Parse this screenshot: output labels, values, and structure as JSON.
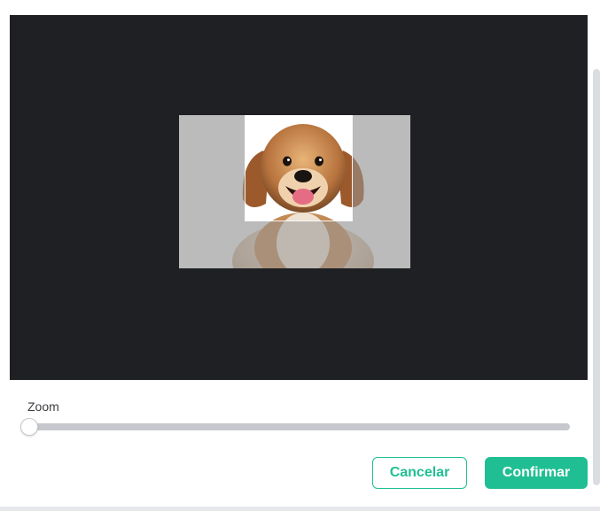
{
  "cropper": {
    "image_description_icon": "dog-photo",
    "background_color": "#1f2024"
  },
  "zoom": {
    "label": "Zoom",
    "value": 0
  },
  "actions": {
    "cancel_label": "Cancelar",
    "confirm_label": "Confirmar"
  },
  "colors": {
    "accent": "#1fbf93"
  }
}
